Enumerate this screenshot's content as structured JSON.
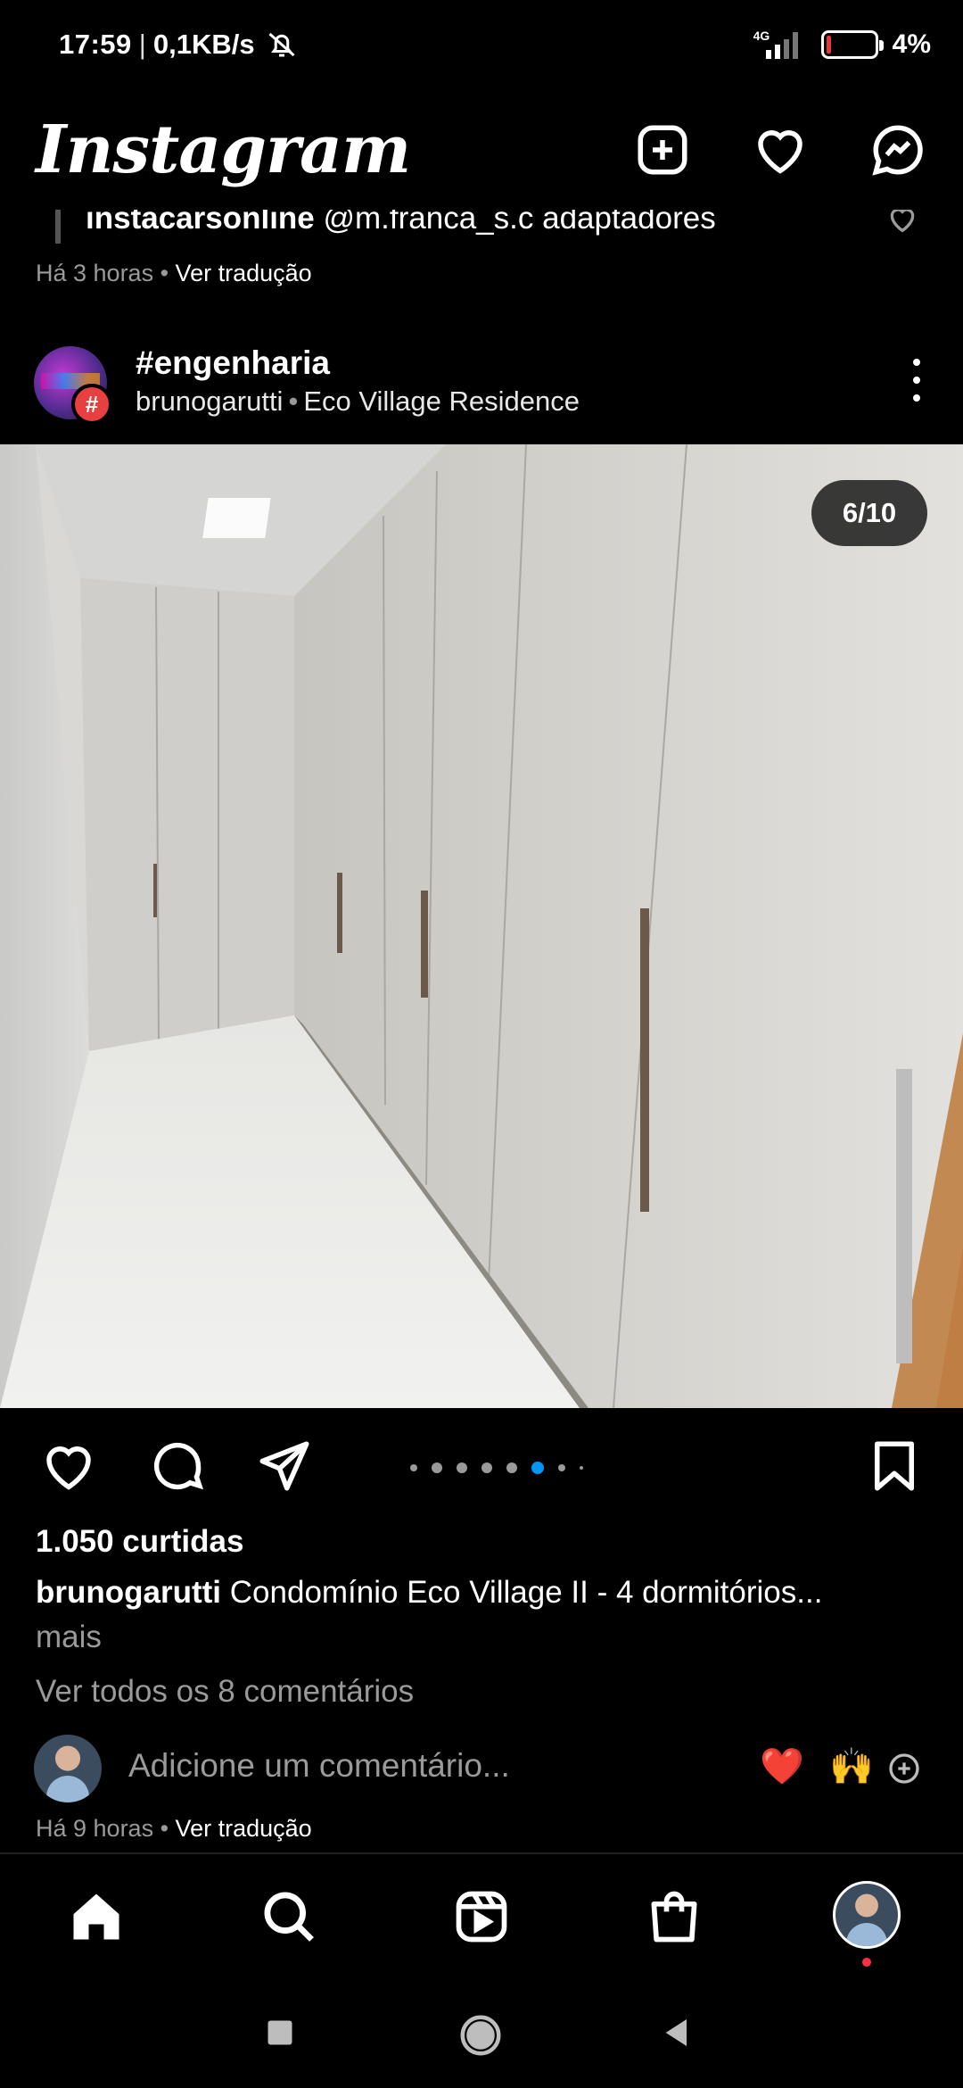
{
  "status": {
    "time": "17:59",
    "separator": "|",
    "net_speed": "0,1KB/s",
    "network_type": "4G",
    "battery": "4%",
    "battery_level": 0.04
  },
  "header": {
    "logo": "Instagram",
    "icons": [
      "add-post-icon",
      "heart-icon",
      "messenger-icon"
    ]
  },
  "prev_post": {
    "comment_user": "instacarsonline",
    "comment_text": "@m.franca_s.c adaptadores",
    "time": "Há 3 horas",
    "translate": "Ver tradução"
  },
  "post": {
    "tag": "#engenharia",
    "username": "brunogarutti",
    "location": "Eco Village Residence",
    "counter": "6/10",
    "current_image": 6,
    "total_images": 10,
    "likes": "1.050 curtidas",
    "caption_user": "brunogarutti",
    "caption_text": "Condomínio Eco Village II - 4 dormitórios...",
    "more": "mais",
    "view_comments": "Ver todos os 8 comentários",
    "comment_placeholder": "Adicione um comentário...",
    "emoji_1": "❤️",
    "emoji_2": "🙌",
    "time": "Há 9 horas",
    "translate": "Ver tradução"
  },
  "colors": {
    "background": "#000000",
    "secondary_text": "#9a9a9a",
    "carousel_active": "#0095f6",
    "notification": "#ff3040"
  }
}
